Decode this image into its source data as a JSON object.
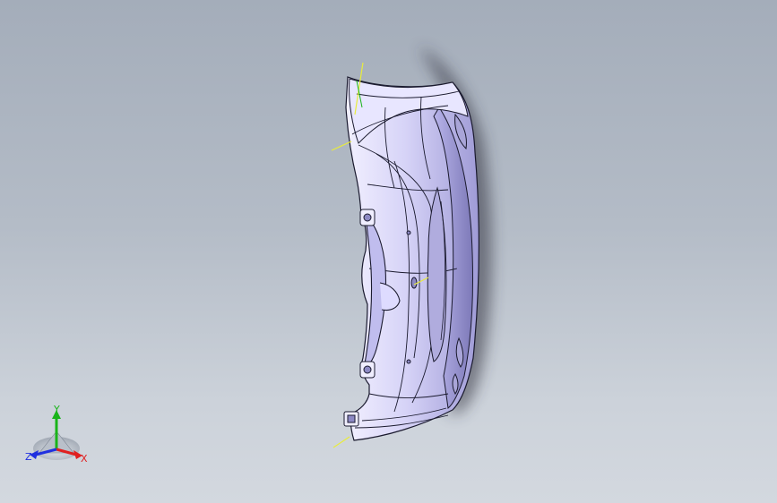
{
  "triad": {
    "x_label": "X",
    "y_label": "Y",
    "z_label": "Z",
    "colors": {
      "x": "#e02020",
      "y": "#19b419",
      "z": "#2030e0"
    }
  },
  "model": {
    "icon": "bumper-part-icon",
    "body_color": "#c9c6f4",
    "edge_color": "#1a1a2e",
    "highlight_color": "#eeeaff",
    "shadow_color": "#3a3a4a",
    "axis_line_color": "#e8ec3c"
  }
}
